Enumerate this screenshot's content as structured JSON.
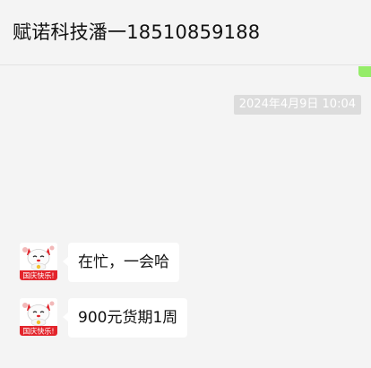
{
  "chat": {
    "title": "赋诺科技潘一18510859188",
    "timestamp": "2024年4月9日 10:04"
  },
  "messages": [
    {
      "text": "在忙，一会哈",
      "avatar_icon": "lucky-cat-icon"
    },
    {
      "text": "900元货期1周",
      "avatar_icon": "lucky-cat-icon"
    }
  ],
  "avatar": {
    "banner_text": "国庆快乐!"
  },
  "colors": {
    "background": "#f4f4f4",
    "bubble": "#ffffff",
    "sent_accent": "#95ec69",
    "timestamp_bg": "#dcdcdc",
    "avatar_red": "#e3242b"
  }
}
